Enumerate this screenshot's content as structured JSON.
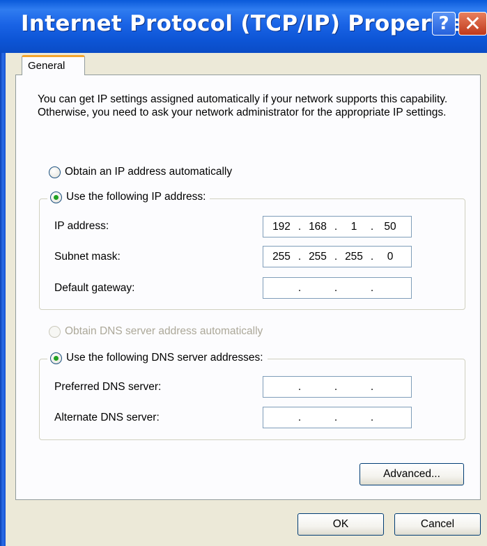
{
  "window": {
    "title": "Internet Protocol (TCP/IP) Properties",
    "help_label": "?",
    "close_label": "✕"
  },
  "tabs": [
    {
      "label": "General",
      "active": true
    }
  ],
  "intro_text": "You can get IP settings assigned automatically if your network supports this capability. Otherwise, you need to ask your network administrator for the appropriate IP settings.",
  "ip_mode": {
    "auto_label": "Obtain an IP address automatically",
    "manual_label": "Use the following IP address:",
    "selected": "manual"
  },
  "ip_fields": {
    "ip_address": {
      "label": "IP address:",
      "octets": [
        "192",
        "168",
        "1",
        "50"
      ]
    },
    "subnet_mask": {
      "label": "Subnet mask:",
      "octets": [
        "255",
        "255",
        "255",
        "0"
      ]
    },
    "default_gateway": {
      "label": "Default gateway:",
      "octets": [
        "",
        "",
        "",
        ""
      ]
    }
  },
  "dns_mode": {
    "auto_label": "Obtain DNS server address automatically",
    "manual_label": "Use the following DNS server addresses:",
    "selected": "manual",
    "auto_disabled": true
  },
  "dns_fields": {
    "preferred": {
      "label": "Preferred DNS server:",
      "octets": [
        "",
        "",
        "",
        ""
      ]
    },
    "alternate": {
      "label": "Alternate DNS server:",
      "octets": [
        "",
        "",
        "",
        ""
      ]
    }
  },
  "buttons": {
    "advanced": "Advanced...",
    "ok": "OK",
    "cancel": "Cancel"
  }
}
